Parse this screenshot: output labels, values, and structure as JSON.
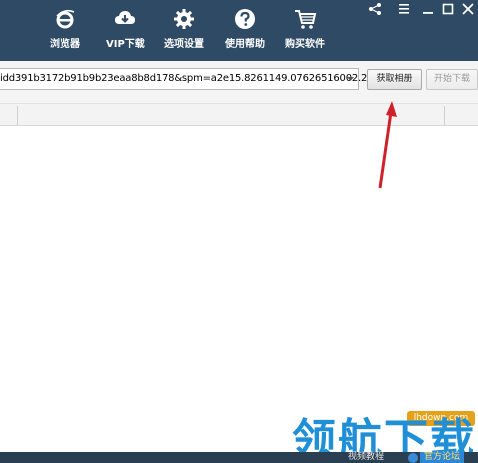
{
  "toolbar": {
    "items": [
      {
        "label": "浏览器",
        "icon": "browser-e-icon"
      },
      {
        "label": "VIP下载",
        "icon": "cloud-download-icon"
      },
      {
        "label": "选项设置",
        "icon": "gear-icon"
      },
      {
        "label": "使用帮助",
        "icon": "help-icon"
      },
      {
        "label": "购买软件",
        "icon": "cart-icon"
      }
    ],
    "active_index": 1,
    "window_controls": [
      "share-icon",
      "menu-icon",
      "minimize-icon",
      "maximize-icon",
      "close-icon"
    ]
  },
  "url_bar": {
    "value": "idd391b3172b91b9b23eaa8b8d178&spm=a2e15.8261149.07626516002.2"
  },
  "buttons": {
    "fetch_album": "获取相册",
    "start_download": "开始下载"
  },
  "watermark": {
    "site_url": "lhdown.com",
    "brand": "领航下载"
  },
  "status_bar": {
    "left_text": "视频教程",
    "right_text": "官方论坛"
  },
  "colors": {
    "toolbar_bg": "#2f4a64",
    "annotation_arrow": "#d0202a",
    "watermark_blue": "#1f8fd8",
    "watermark_badge": "#e6a11a"
  }
}
